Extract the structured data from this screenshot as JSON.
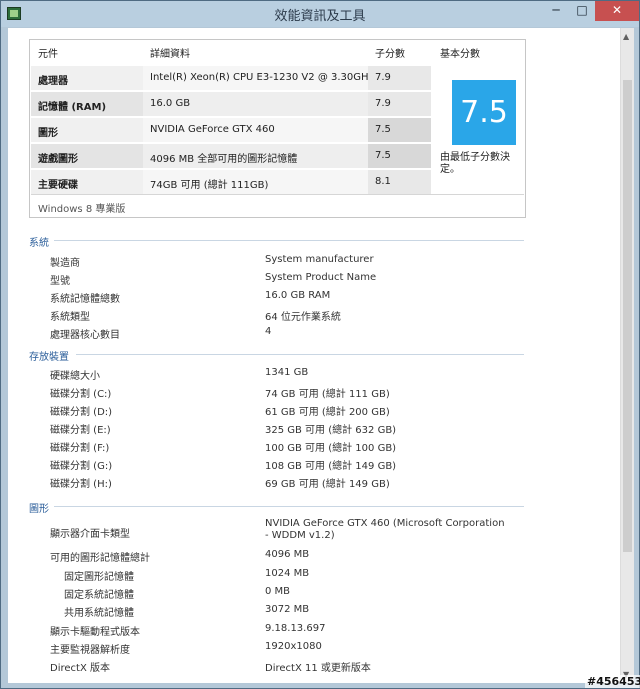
{
  "window": {
    "title": "效能資訊及工具",
    "min": "─",
    "max": "□",
    "close": "✕"
  },
  "rating": {
    "headers": {
      "component": "元件",
      "details": "詳細資料",
      "subscore": "子分數",
      "base": "基本分數"
    },
    "rows": [
      {
        "component": "處理器",
        "details": "Intel(R) Xeon(R) CPU E3-1230 V2 @ 3.30GHz",
        "subscore": "7.9"
      },
      {
        "component": "記憶體 (RAM)",
        "details": "16.0 GB",
        "subscore": "7.9"
      },
      {
        "component": "圖形",
        "details": "NVIDIA GeForce GTX 460",
        "subscore": "7.5"
      },
      {
        "component": "遊戲圖形",
        "details": "4096 MB 全部可用的圖形記憶體",
        "subscore": "7.5"
      },
      {
        "component": "主要硬碟",
        "details": "74GB 可用 (總計 111GB)",
        "subscore": "8.1"
      }
    ],
    "base_score": "7.5",
    "base_desc": "由最低子分數決定。",
    "edition": "Windows 8 專業版",
    "tile_color": "#2aa6e8"
  },
  "system": {
    "heading": "系統",
    "items": [
      {
        "label": "製造商",
        "value": "System manufacturer"
      },
      {
        "label": "型號",
        "value": "System Product Name"
      },
      {
        "label": "系統記憶體總數",
        "value": "16.0 GB RAM"
      },
      {
        "label": "系統類型",
        "value": "64 位元作業系統"
      },
      {
        "label": "處理器核心數目",
        "value": "4"
      }
    ]
  },
  "storage": {
    "heading": "存放裝置",
    "items": [
      {
        "label": "硬碟總大小",
        "value": "1341 GB"
      },
      {
        "label": "磁碟分割 (C:)",
        "value": "74 GB 可用 (總計 111 GB)"
      },
      {
        "label": "磁碟分割 (D:)",
        "value": "61 GB 可用 (總計 200 GB)"
      },
      {
        "label": "磁碟分割 (E:)",
        "value": "325 GB 可用 (總計 632 GB)"
      },
      {
        "label": "磁碟分割 (F:)",
        "value": "100 GB 可用 (總計 100 GB)"
      },
      {
        "label": "磁碟分割 (G:)",
        "value": "108 GB 可用 (總計 149 GB)"
      },
      {
        "label": "磁碟分割 (H:)",
        "value": "69 GB 可用 (總計 149 GB)"
      }
    ]
  },
  "graphics": {
    "heading": "圖形",
    "items": [
      {
        "label": "顯示器介面卡類型",
        "value": "NVIDIA GeForce GTX 460 (Microsoft Corporation - WDDM v1.2)"
      },
      {
        "label": "可用的圖形記憶體總計",
        "value": "4096 MB"
      },
      {
        "label": "固定圖形記憶體",
        "value": "1024 MB"
      },
      {
        "label": "固定系統記憶體",
        "value": "0 MB"
      },
      {
        "label": "共用系統記憶體",
        "value": "3072 MB"
      },
      {
        "label": "顯示卡驅動程式版本",
        "value": "9.18.13.697"
      },
      {
        "label": "主要監視器解析度",
        "value": "1920x1080"
      },
      {
        "label": "DirectX 版本",
        "value": "DirectX 11 或更新版本"
      }
    ]
  },
  "watermark": "#456453"
}
